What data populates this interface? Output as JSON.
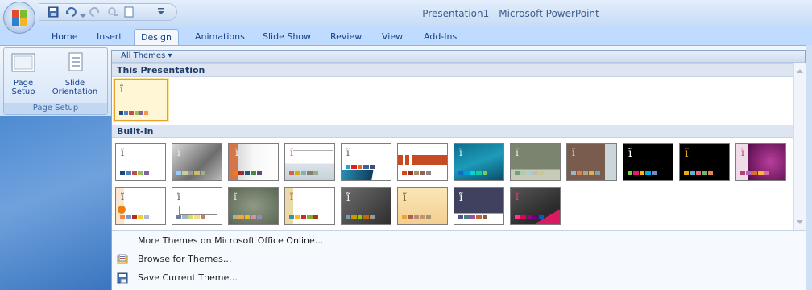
{
  "window": {
    "title": "Presentation1 - Microsoft PowerPoint"
  },
  "tabs": [
    "Home",
    "Insert",
    "Design",
    "Animations",
    "Slide Show",
    "Review",
    "View",
    "Add-Ins"
  ],
  "active_tab": "Design",
  "ribbon": {
    "page_setup_label": "Page\nSetup",
    "slide_orientation_label": "Slide\nOrientation",
    "group_label": "Page Setup"
  },
  "gallery": {
    "filter_label": "All Themes ▾",
    "this_presentation_label": "This Presentation",
    "builtin_label": "Built-In",
    "menu": {
      "more_themes": "More Themes on Microsoft Office Online...",
      "browse": "Browse for Themes...",
      "save": "Save Current Theme..."
    }
  },
  "colors": {
    "ribbon_blue": "#bfdbff",
    "selection_orange": "#e6a12d",
    "text_blue": "#15428b"
  },
  "icons": {
    "office_button": "office-logo-icon",
    "save": "save-icon",
    "undo": "undo-icon",
    "redo": "redo-icon",
    "browse": "browse-folder-icon",
    "save_theme": "save-theme-icon"
  }
}
